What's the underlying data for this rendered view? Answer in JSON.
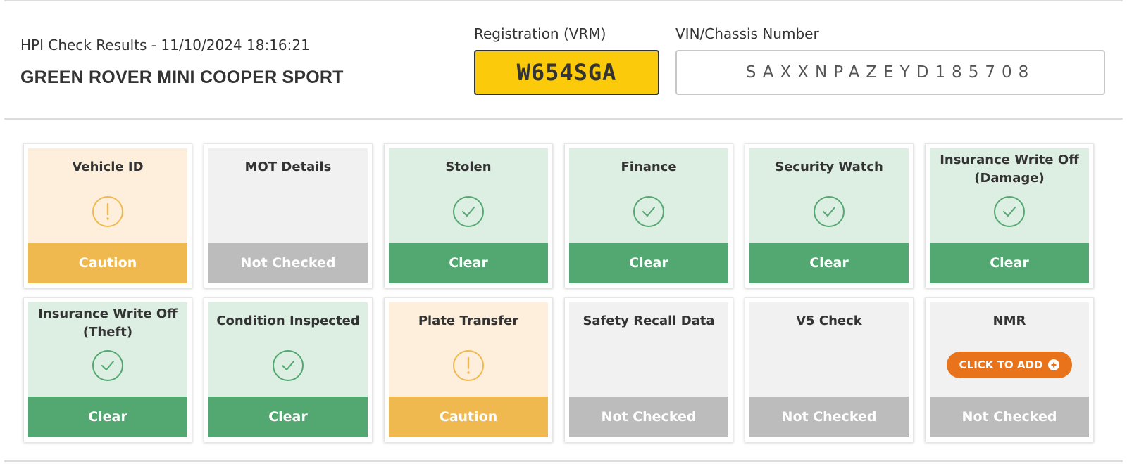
{
  "header": {
    "subtitle": "HPI Check Results - 11/10/2024 18:16:21",
    "vehicle_title": "GREEN ROVER MINI COOPER SPORT",
    "registration_label": "Registration (VRM)",
    "registration_value": "W654SGA",
    "vin_label": "VIN/Chassis Number",
    "vin_value": "SAXXNPAZEYD185708"
  },
  "colors": {
    "caution": "#f0b94f",
    "clear": "#53a872",
    "not_checked": "#bcbcbc",
    "accent_button": "#e8731a",
    "plate_yellow": "#fbcb0b"
  },
  "cards": [
    {
      "title": "Vehicle ID",
      "status": "Caution",
      "icon": "warning-icon"
    },
    {
      "title": "MOT Details",
      "status": "Not Checked",
      "icon": ""
    },
    {
      "title": "Stolen",
      "status": "Clear",
      "icon": "check-icon"
    },
    {
      "title": "Finance",
      "status": "Clear",
      "icon": "check-icon"
    },
    {
      "title": "Security Watch",
      "status": "Clear",
      "icon": "check-icon"
    },
    {
      "title": "Insurance Write Off (Damage)",
      "status": "Clear",
      "icon": "check-icon"
    },
    {
      "title": "Insurance Write Off (Theft)",
      "status": "Clear",
      "icon": "check-icon"
    },
    {
      "title": "Condition Inspected",
      "status": "Clear",
      "icon": "check-icon"
    },
    {
      "title": "Plate Transfer",
      "status": "Caution",
      "icon": "warning-icon"
    },
    {
      "title": "Safety Recall Data",
      "status": "Not Checked",
      "icon": ""
    },
    {
      "title": "V5 Check",
      "status": "Not Checked",
      "icon": ""
    },
    {
      "title": "NMR",
      "status": "Not Checked",
      "icon": "plus-circle-icon",
      "button_label": "CLICK TO ADD"
    }
  ]
}
